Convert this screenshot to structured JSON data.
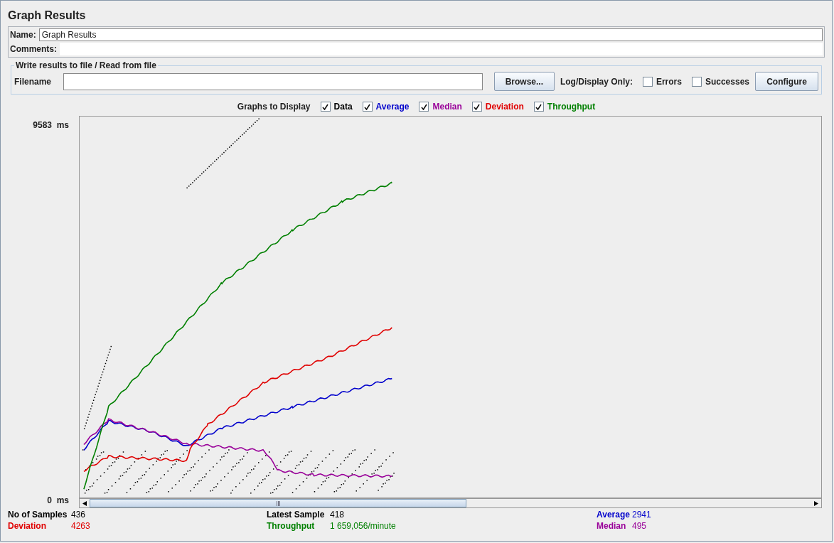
{
  "title": "Graph Results",
  "name_field": {
    "label": "Name:",
    "value": "Graph Results"
  },
  "comments_field": {
    "label": "Comments:"
  },
  "file_group": {
    "legend": "Write results to file / Read from file",
    "filename_label": "Filename",
    "browse_button": "Browse...",
    "log_label": "Log/Display Only:",
    "options": [
      {
        "label": "Errors",
        "checked": false
      },
      {
        "label": "Successes",
        "checked": false
      }
    ],
    "configure_button": "Configure"
  },
  "graphs_label": "Graphs to Display",
  "graphs": [
    {
      "label": "Data",
      "checked": true,
      "color": "#000000"
    },
    {
      "label": "Average",
      "checked": true,
      "color": "#0000cc"
    },
    {
      "label": "Median",
      "checked": true,
      "color": "#990099"
    },
    {
      "label": "Deviation",
      "checked": true,
      "color": "#e00000"
    },
    {
      "label": "Throughput",
      "checked": true,
      "color": "#008000"
    }
  ],
  "y_max_label": "9583  ms",
  "y_min_label": "0  ms",
  "stats": [
    {
      "label": "No of Samples",
      "value": "436",
      "color": "#000000"
    },
    {
      "label": "Latest Sample",
      "value": "418",
      "color": "#000000"
    },
    {
      "label": "Average",
      "value": "2941",
      "color": "#0000cc"
    },
    {
      "label": "Deviation",
      "value": "4263",
      "color": "#e00000"
    },
    {
      "label": "Throughput",
      "value": "1 659,056/minute",
      "color": "#008000"
    },
    {
      "label": "Median",
      "value": "495",
      "color": "#990099"
    }
  ]
}
